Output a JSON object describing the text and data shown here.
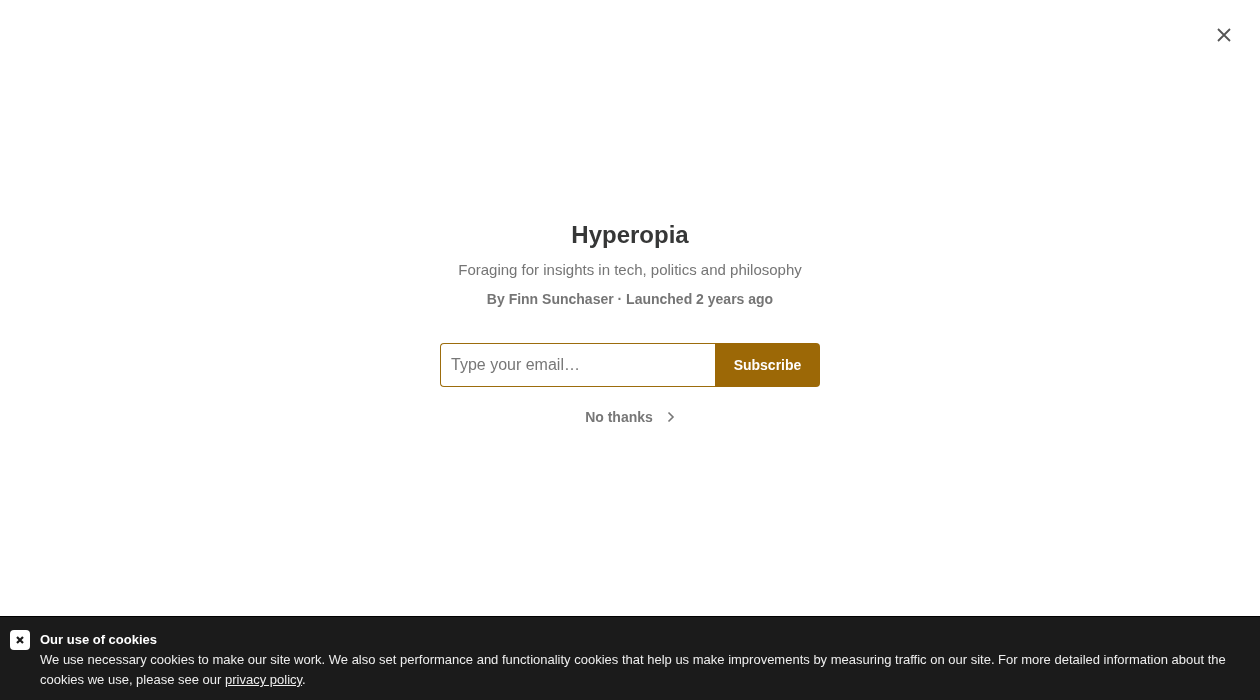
{
  "title": "Hyperopia",
  "tagline": "Foraging for insights in tech, politics and philosophy",
  "byline": "By Finn Sunchaser · Launched 2 years ago",
  "email_field": {
    "placeholder": "Type your email…"
  },
  "subscribe_button": "Subscribe",
  "skip_link": "No thanks",
  "cookie_banner": {
    "title": "Our use of cookies",
    "text": "We use necessary cookies to make our site work. We also set performance and functionality cookies that help us make improvements by measuring traffic on our site. For more detailed information about the cookies we use, please see our ",
    "link": "privacy policy",
    "end": "."
  }
}
